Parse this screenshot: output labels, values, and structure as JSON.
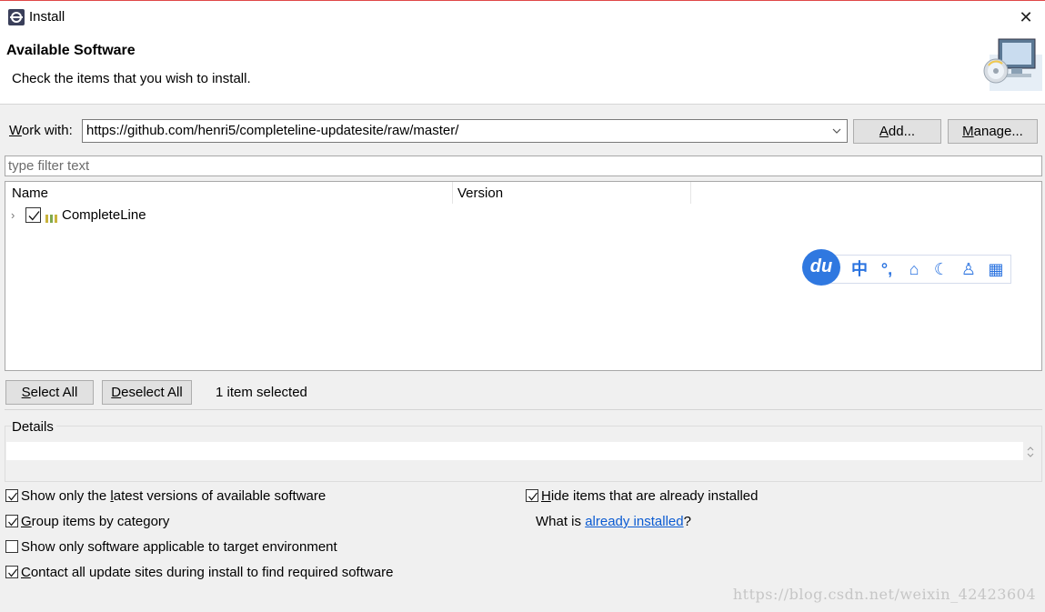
{
  "window": {
    "title": "Install",
    "close_glyph": "✕"
  },
  "header": {
    "title": "Available Software",
    "description": "Check the items that you wish to install."
  },
  "work_with": {
    "label_prefix": "W",
    "label_rest": "ork with:",
    "value": "https://github.com/henri5/completeline-updatesite/raw/master/",
    "add_prefix": "A",
    "add_rest": "dd...",
    "manage_prefix": "M",
    "manage_rest": "anage..."
  },
  "filter": {
    "placeholder": "type filter text"
  },
  "table": {
    "columns": [
      "Name",
      "Version"
    ],
    "rows": [
      {
        "name": "CompleteLine",
        "version": "",
        "checked": true,
        "expand_glyph": "›"
      }
    ]
  },
  "ime_toolbar": {
    "logo": "du",
    "items": [
      "中",
      "°,",
      "⌂",
      "☾",
      "♙",
      "▦"
    ]
  },
  "selection": {
    "select_all_prefix": "S",
    "select_all_rest": "elect All",
    "deselect_all_prefix": "D",
    "deselect_all_rest": "eselect All",
    "count_text": "1 item selected"
  },
  "details": {
    "label": "Details",
    "value": ""
  },
  "options": {
    "latest_pre": "Show only the ",
    "latest_mn": "l",
    "latest_post": "atest versions of available software",
    "latest_checked": true,
    "group_pre": "",
    "group_mn": "G",
    "group_post": "roup items by category",
    "group_checked": true,
    "applicable_text": "Show only software applicable to target environment",
    "applicable_checked": false,
    "contact_pre": "",
    "contact_mn": "C",
    "contact_post": "ontact all update sites during install to find required software",
    "contact_checked": true,
    "hide_pre": "",
    "hide_mn": "H",
    "hide_post": "ide items that are already installed",
    "hide_checked": true,
    "what_is_prefix": "What is ",
    "what_is_link": "already installed",
    "what_is_suffix": "?"
  },
  "watermark": "https://blog.csdn.net/weixin_42423604",
  "colors": {
    "accent_link": "#0b5bd2",
    "ime_blue": "#2f78e0",
    "window_border": "#e04848"
  }
}
